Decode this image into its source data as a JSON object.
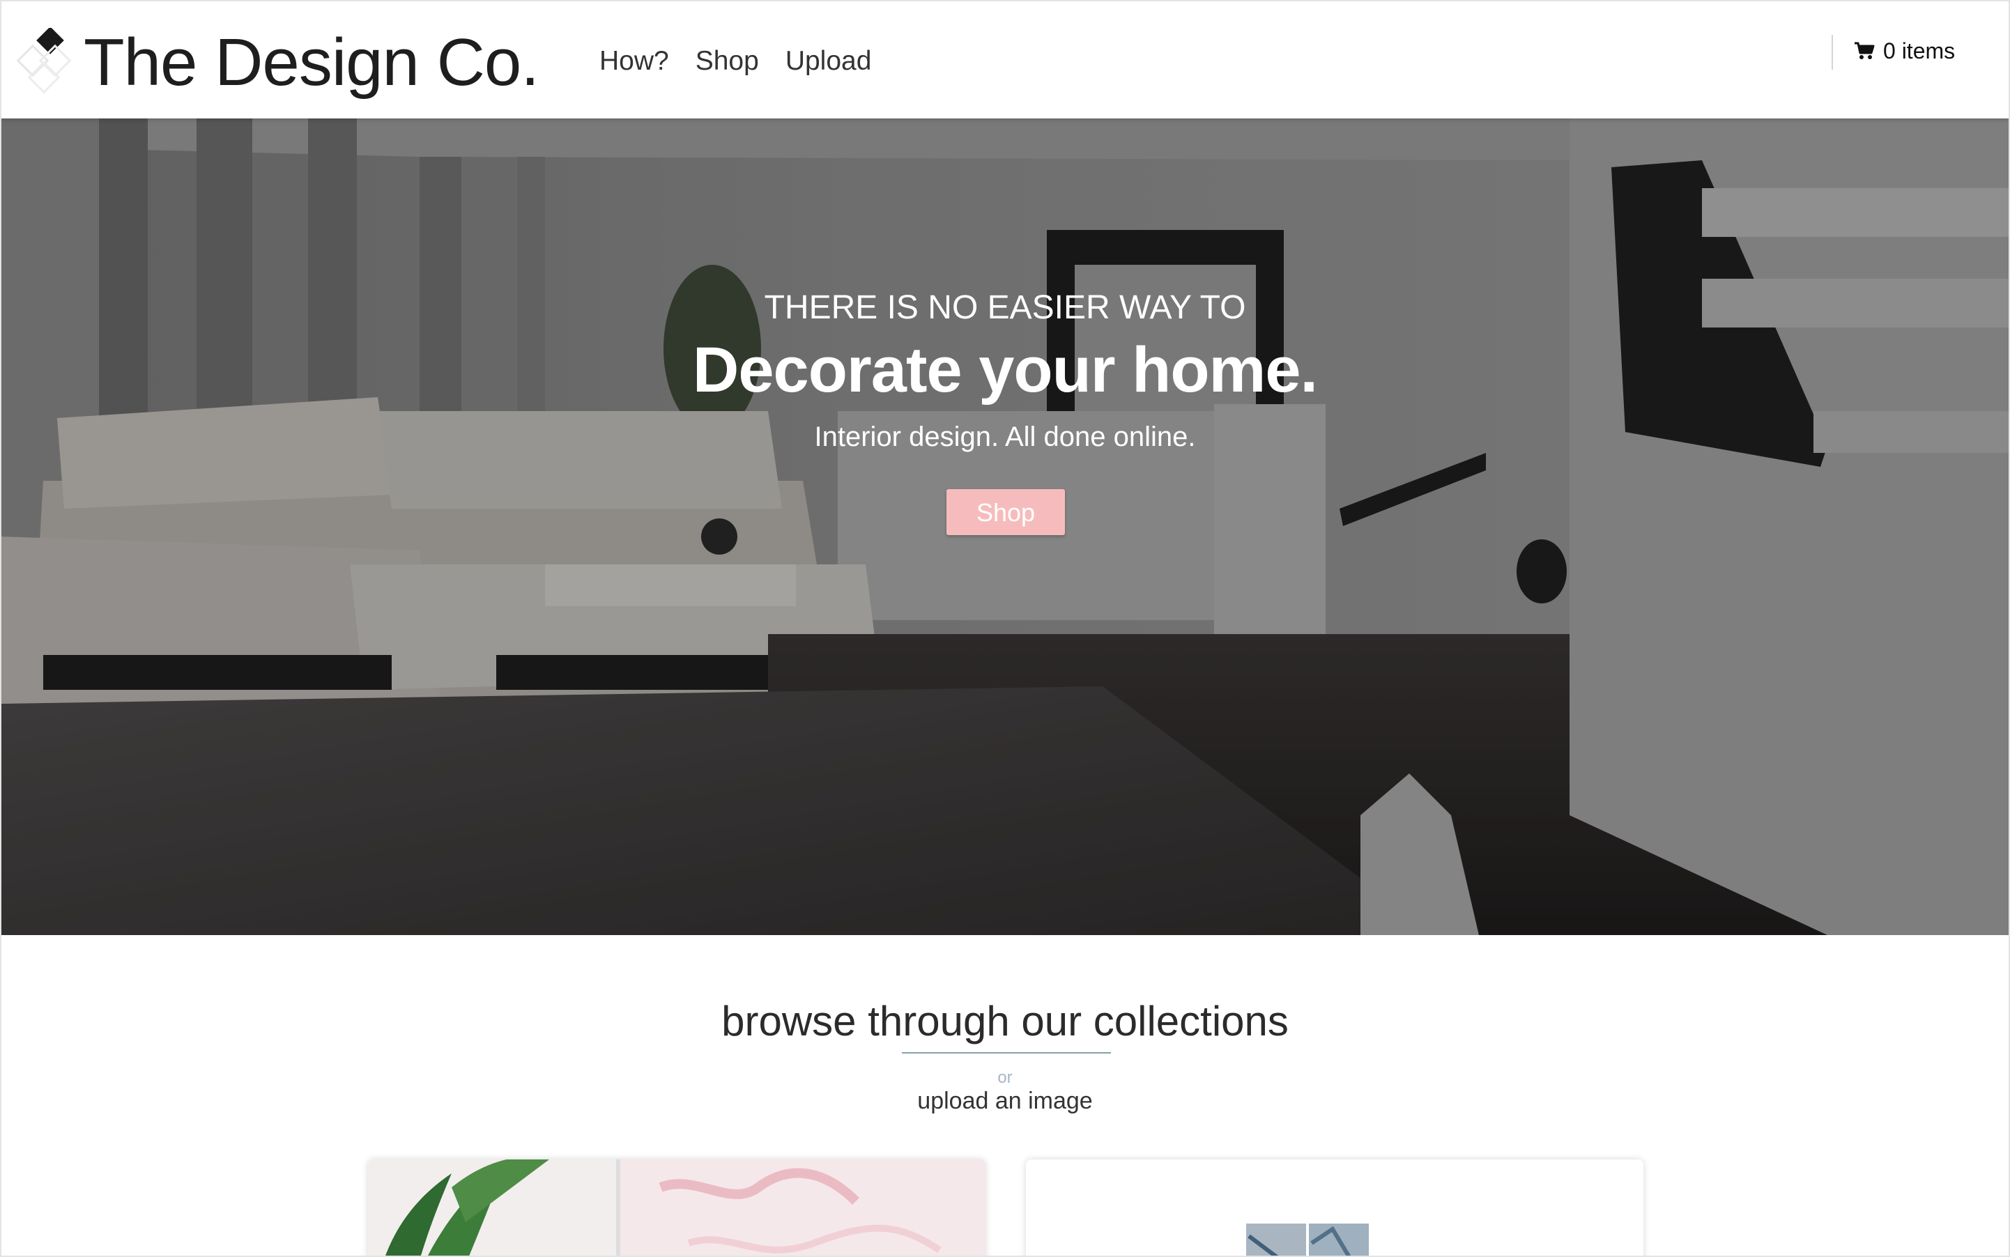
{
  "header": {
    "logo_text": "The Design Co.",
    "nav": [
      {
        "label": "How?"
      },
      {
        "label": "Shop"
      },
      {
        "label": "Upload"
      }
    ],
    "cart": {
      "icon": "cart-icon",
      "label": "0 items"
    }
  },
  "hero": {
    "kicker": "THERE IS NO EASIER WAY TO",
    "title": "Decorate your home.",
    "subtitle": "Interior design. All done online.",
    "button_label": "Shop",
    "button_color": "#f6bcbd"
  },
  "browse": {
    "title": "browse through our collections",
    "or_text": "or",
    "upload_link": "upload an image"
  }
}
